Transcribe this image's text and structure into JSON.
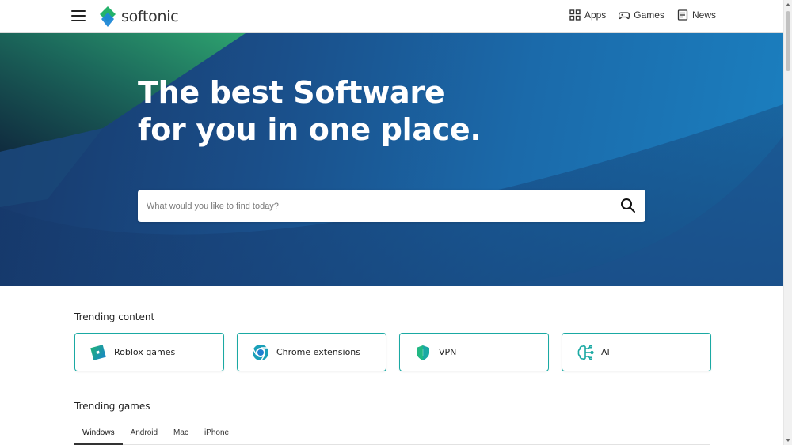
{
  "header": {
    "logo_text": "softonic",
    "nav": [
      {
        "label": "Apps",
        "icon": "apps-grid-icon"
      },
      {
        "label": "Games",
        "icon": "gamepad-icon"
      },
      {
        "label": "News",
        "icon": "news-icon"
      }
    ]
  },
  "hero": {
    "title_line1": "The best Software",
    "title_line2": "for you in one place.",
    "search_placeholder": "What would you like to find today?"
  },
  "trending": {
    "title": "Trending content",
    "items": [
      {
        "label": "Roblox games",
        "icon": "roblox-icon"
      },
      {
        "label": "Chrome extensions",
        "icon": "chrome-icon"
      },
      {
        "label": "VPN",
        "icon": "shield-icon"
      },
      {
        "label": "AI",
        "icon": "ai-brain-icon"
      }
    ]
  },
  "games": {
    "title": "Trending games",
    "tabs": [
      "Windows",
      "Android",
      "Mac",
      "iPhone"
    ],
    "active_tab": "Windows"
  },
  "colors": {
    "accent_teal": "#1aa9a3",
    "hero_blue": "#1b6aaa",
    "hero_green": "#2f9a6e"
  }
}
